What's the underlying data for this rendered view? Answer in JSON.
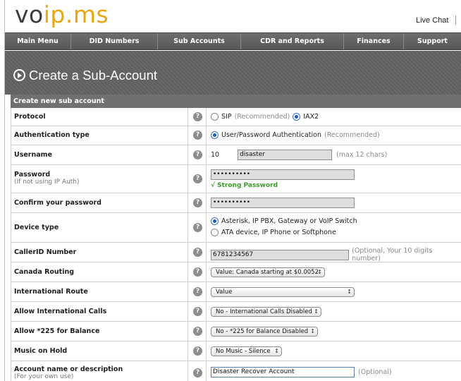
{
  "header": {
    "logo_part1": "vo",
    "logo_part2": "ip",
    "logo_part3": ".ms",
    "live_chat": "Live Chat"
  },
  "nav": [
    "Main Menu",
    "DID Numbers",
    "Sub Accounts",
    "CDR and Reports",
    "Finances",
    "Support"
  ],
  "page_title": "Create a Sub-Account",
  "section_title": "Create new sub account",
  "colors": {
    "nav_bg": "#5f5f5f",
    "logo_accent": "#e8a60f",
    "strong_password": "#3a9b2a",
    "radio_selected": "#1a5bc4"
  },
  "help_glyph": "?",
  "protocol": {
    "label": "Protocol",
    "opt1": "SIP",
    "opt1_note": "(Recommended)",
    "opt2": "IAX2",
    "selected": "IAX2"
  },
  "auth": {
    "label": "Authentication type",
    "opt1": "User/Password Authentication",
    "opt1_note": "(Recommended)"
  },
  "username": {
    "label": "Username",
    "prefix": "10",
    "value": "disaster",
    "note": "(max 12 chars)"
  },
  "password": {
    "label": "Password",
    "sublabel": "(If not using IP Auth)",
    "value": "••••••••••",
    "strength": "√ Strong Password"
  },
  "confirm": {
    "label": "Confirm your password",
    "value": "••••••••••"
  },
  "device": {
    "label": "Device type",
    "opt1": "Asterisk, IP PBX, Gateway or VoIP Switch",
    "opt2": "ATA device, IP Phone or Softphone"
  },
  "callerid": {
    "label": "CallerID Number",
    "value": "6781234567",
    "note": "(Optional, Your 10 digits number)"
  },
  "canada": {
    "label": "Canada Routing",
    "value": "Value: Canada starting at $0.0052"
  },
  "intl_route": {
    "label": "International Route",
    "value": "Value"
  },
  "allow_intl": {
    "label": "Allow International Calls",
    "value": "No - International Calls Disabled"
  },
  "allow225": {
    "label": "Allow *225 for Balance",
    "value": "No - *225 for Balance Disabled"
  },
  "moh": {
    "label": "Music on Hold",
    "value": "No Music - Silence"
  },
  "account": {
    "label": "Account name or description",
    "sublabel": "(For your own use)",
    "value": "Disaster Recover Account",
    "note": "(Optional)"
  }
}
